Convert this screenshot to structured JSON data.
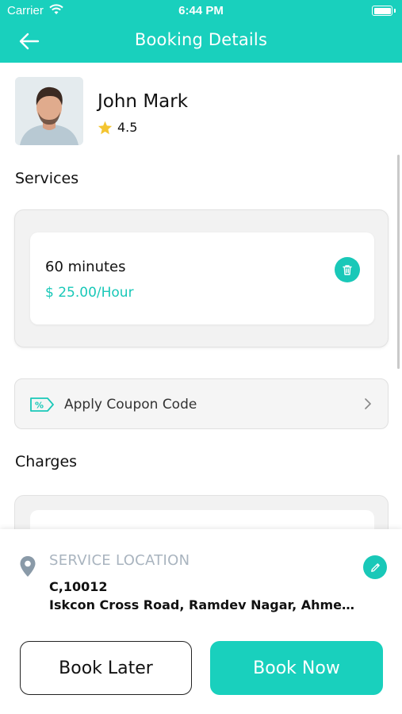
{
  "status_bar": {
    "carrier": "Carrier",
    "time": "6:44 PM"
  },
  "header": {
    "title": "Booking Details",
    "back_icon": "arrow-left-icon"
  },
  "provider": {
    "name": "John Mark",
    "rating": "4.5"
  },
  "services": {
    "title": "Services",
    "items": [
      {
        "name": "60 minutes",
        "price": "$ 25.00/Hour"
      }
    ]
  },
  "coupon": {
    "label": "Apply Coupon Code"
  },
  "charges": {
    "title": "Charges"
  },
  "location": {
    "label": "SERVICE LOCATION",
    "line1": "C,10012",
    "line2": "Iskcon Cross Road, Ramdev Nagar, Ahmedab..."
  },
  "actions": {
    "book_later": "Book Later",
    "book_now": "Book Now"
  },
  "colors": {
    "accent": "#19d0bd",
    "star": "#f4c531",
    "muted": "#a9b4bf"
  }
}
